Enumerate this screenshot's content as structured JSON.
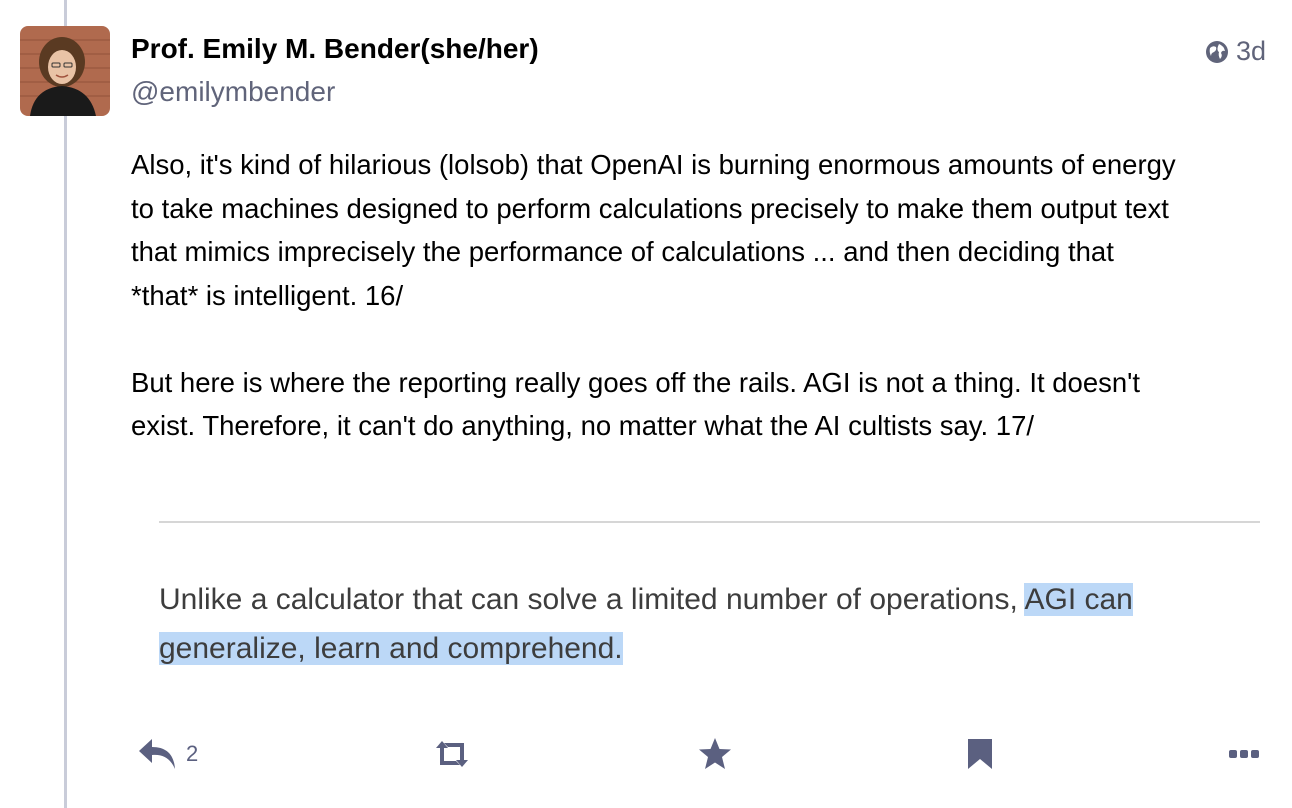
{
  "post": {
    "author": {
      "display_name": "Prof. Emily M. Bender(she/her)",
      "handle": "@emilymbender"
    },
    "visibility_icon": "globe-icon",
    "timestamp": "3d",
    "paragraphs": [
      "Also, it's kind of hilarious (lolsob) that OpenAI is burning enormous amounts of energy\nto take machines designed to perform calculations precisely to make them output text\nthat mimics imprecisely the performance of calculations ... and then deciding that\n*that* is intelligent. 16/",
      "But here is where the reporting really goes off the rails. AGI is not a thing. It doesn't\nexist. Therefore, it can't do anything, no matter what the AI cultists say. 17/"
    ],
    "embedded_quote": {
      "plain_text": "Unlike a calculator that can solve a limited number of operations, ",
      "highlighted_line1": "AGI can",
      "highlighted_line2": "generalize, learn and comprehend."
    },
    "actions": {
      "reply": {
        "icon": "reply-icon",
        "count": "2"
      },
      "boost": {
        "icon": "boost-icon"
      },
      "favourite": {
        "icon": "star-icon"
      },
      "bookmark": {
        "icon": "bookmark-icon"
      },
      "more": {
        "icon": "more-icon"
      }
    },
    "colors": {
      "icon": "#5b6080",
      "highlight": "#bcd8f7",
      "thread_line": "#c9ccd9"
    }
  }
}
